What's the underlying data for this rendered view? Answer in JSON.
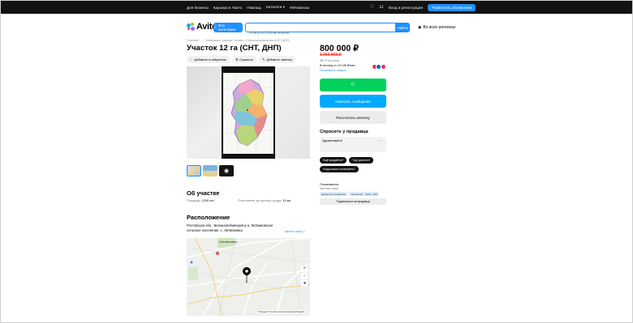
{
  "topbar": {
    "links": [
      "Для бизнеса",
      "Карьера в Авито",
      "Помощь",
      "Каталоги ▾",
      "#яПомогаю"
    ],
    "login": "Вход и регистрация",
    "post_button": "Разместить объявление"
  },
  "header": {
    "logo_text": "Avito",
    "categories_button": "Все категории",
    "search_placeholder": "Поиск по объявлениям",
    "find_button": "Найти",
    "region": "Во всех регионах"
  },
  "breadcrumb": "Главная › ... › Земельные участки › Купить › Сельхозназначения (СНТ, ДНП)",
  "title": "Участок 12 га (СНТ, ДНП)",
  "actions": {
    "favorite": "Добавить в избранное",
    "compare": "Сравнить",
    "note": "Добавить заметку"
  },
  "gallery": {
    "thumb_more_icon": "camera-icon"
  },
  "about": {
    "heading": "Об участке",
    "area_label": "Площадь:",
    "area_value": "1200 сот.",
    "distance_label": "Расстояние до центра города:",
    "distance_value": "13 км"
  },
  "location": {
    "heading": "Расположение",
    "address": "Ростовская обл., Белокалитвинский р-н, Литвиновское сельское поселение, с. Литвиновка",
    "hide_map": "Скрыть карту ^",
    "map_village": "Литвиновка",
    "map_copyright": "© Яндекс Условия использования  Яндекс"
  },
  "price": {
    "current": "800 000 ₽",
    "old": "1 050 000 ₽",
    "per_unit": "667 ₽ за сотку",
    "mortgage": "В ипотеку от 19 195 ₽/мес.",
    "mortgage_link": "Посмотреть скидки"
  },
  "buttons": {
    "show_phone": "С",
    "write_message": "Написать сообщение",
    "mortgage_calc": "Рассчитать ипотеку"
  },
  "ask": {
    "heading": "Спросите у продавца",
    "message_value": "Здравствуйте!",
    "chips": [
      "Ещё продаётся?",
      "Торг уместен?",
      "Когда можно посмотреть?"
    ]
  },
  "seller": {
    "name": "Пользователь",
    "type": "Частное лицо",
    "badges": [
      "Документы проверены",
      "Экземпляр · 14/11 • 10%"
    ],
    "subscribe": "Подписаться на продавца"
  },
  "colors": {
    "accent_blue": "#1e90ff",
    "green": "#02d15c",
    "light_blue": "#00aaff",
    "price_red": "#ff3b30"
  }
}
